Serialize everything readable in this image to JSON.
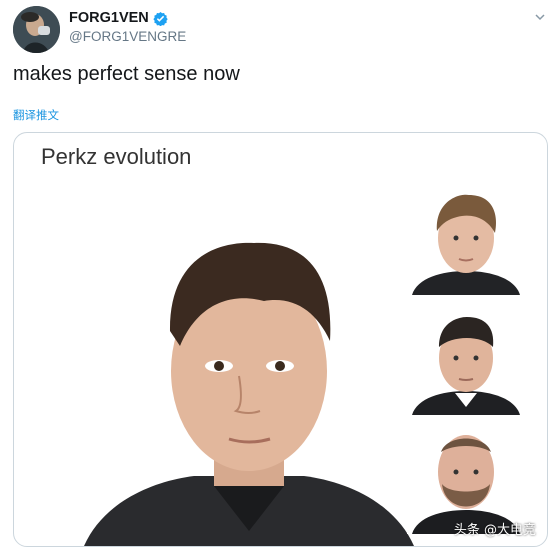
{
  "tweet": {
    "display_name": "FORG1VEN",
    "handle": "@FORG1VENGRE",
    "text": "makes perfect sense now",
    "translate_label": "翻译推文"
  },
  "media": {
    "title": "Perkz evolution",
    "photos": [
      "main-portrait",
      "portrait-1",
      "portrait-2",
      "portrait-3"
    ]
  },
  "watermark": "头条 @大电竞",
  "icons": [
    "verified-badge-icon",
    "chevron-down-icon"
  ],
  "colors": {
    "link": "#1b95e0",
    "verified": "#1da1f2",
    "secondary_text": "#657786"
  }
}
